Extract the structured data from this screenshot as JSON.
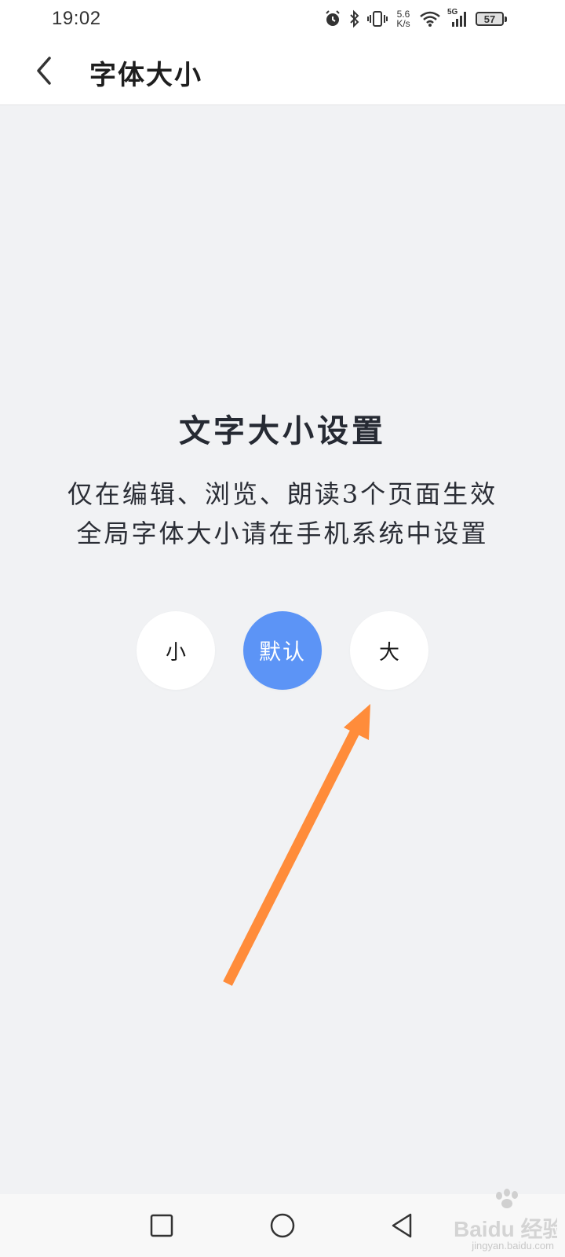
{
  "status_bar": {
    "time": "19:02",
    "net_speed_value": "5.6",
    "net_speed_unit": "K/s",
    "signal_label": "5G",
    "battery": "57",
    "icons": [
      "alarm-icon",
      "bluetooth-icon",
      "vibrate-icon",
      "wifi-icon",
      "signal-icon",
      "battery-icon"
    ]
  },
  "header": {
    "back_icon": "chevron-left-icon",
    "title": "字体大小"
  },
  "main": {
    "heading": "文字大小设置",
    "description_line1": "仅在编辑、浏览、朗读3个页面生效",
    "description_line2": "全局字体大小请在手机系统中设置",
    "options": [
      {
        "label": "小",
        "selected": false
      },
      {
        "label": "默认",
        "selected": true
      },
      {
        "label": "大",
        "selected": false
      }
    ],
    "selected_color": "#5c94f6"
  },
  "annotation": {
    "arrow_color": "#ff8c3a"
  },
  "nav_bar": {
    "buttons": [
      "recent-apps-icon",
      "home-icon",
      "back-triangle-icon"
    ]
  },
  "watermark": {
    "brand": "Baidu 经验",
    "url": "jingyan.baidu.com"
  }
}
